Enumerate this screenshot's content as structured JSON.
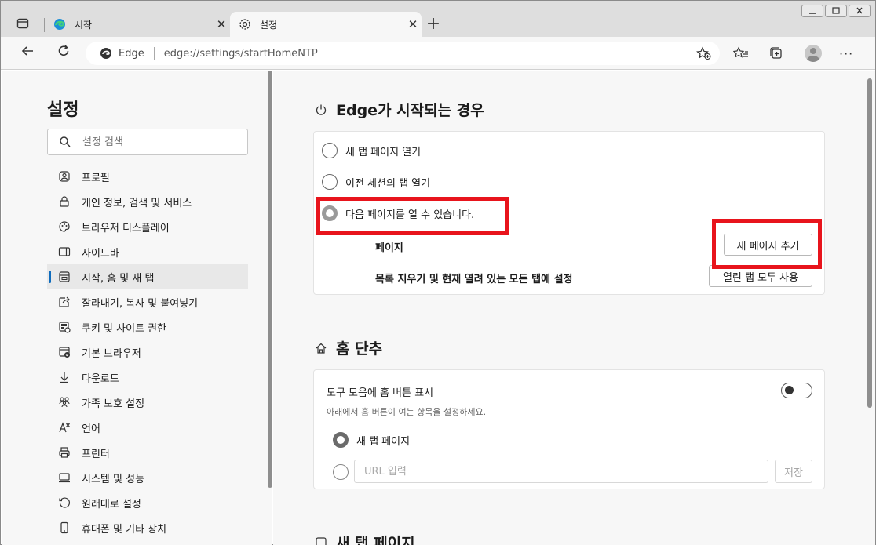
{
  "tabs": [
    {
      "title": "시작",
      "icon": "edge-icon"
    },
    {
      "title": "설정",
      "icon": "gear-icon"
    }
  ],
  "tab_close_glyph": "✕",
  "new_tab_glyph": "+",
  "omnibox": {
    "site": "Edge",
    "url": "edge://settings/startHomeNTP"
  },
  "more_glyph": "···",
  "sidebar": {
    "title": "설정",
    "search_placeholder": "설정 검색",
    "items": [
      {
        "label": "프로필",
        "icon": "profile-icon"
      },
      {
        "label": "개인 정보, 검색 및 서비스",
        "icon": "lock-icon"
      },
      {
        "label": "브라우저 디스플레이",
        "icon": "palette-icon"
      },
      {
        "label": "사이드바",
        "icon": "sidebar-icon"
      },
      {
        "label": "시작, 홈 및 새 탭",
        "icon": "start-home-icon",
        "active": true
      },
      {
        "label": "잘라내기, 복사 및 붙여넣기",
        "icon": "share-icon"
      },
      {
        "label": "쿠키 및 사이트 권한",
        "icon": "cookie-icon"
      },
      {
        "label": "기본 브라우저",
        "icon": "default-browser-icon"
      },
      {
        "label": "다운로드",
        "icon": "download-icon"
      },
      {
        "label": "가족 보호 설정",
        "icon": "family-icon"
      },
      {
        "label": "언어",
        "icon": "language-icon"
      },
      {
        "label": "프린터",
        "icon": "printer-icon"
      },
      {
        "label": "시스템 및 성능",
        "icon": "system-icon"
      },
      {
        "label": "원래대로 설정",
        "icon": "reset-icon"
      },
      {
        "label": "휴대폰 및 기타 장치",
        "icon": "phone-icon"
      }
    ]
  },
  "startup": {
    "title": "Edge가 시작되는 경우",
    "options": [
      {
        "label": "새 탭 페이지 열기",
        "selected": false
      },
      {
        "label": "이전 세션의 탭 열기",
        "selected": false
      },
      {
        "label": "다음 페이지를 열 수 있습니다.",
        "selected": true
      }
    ],
    "pages_label": "페이지",
    "add_page_button": "새 페이지 추가",
    "clear_label": "목록 지우기 및 현재 열려 있는 모든 탭에 설정",
    "use_open_tabs_button": "열린 탭 모두 사용"
  },
  "home": {
    "title": "홈 단추",
    "toggle_label": "도구 모음에 홈 버튼 표시",
    "toggle_on": false,
    "sub_label": "아래에서 홈 버튼이 여는 항목을 설정하세요.",
    "new_tab_option": "새 탭 페이지",
    "url_placeholder": "URL 입력",
    "save_button": "저장"
  },
  "next_section_peek": "새 탭 페이지",
  "colors": {
    "highlight": "#e8141c",
    "accent": "#0f6cbd"
  }
}
